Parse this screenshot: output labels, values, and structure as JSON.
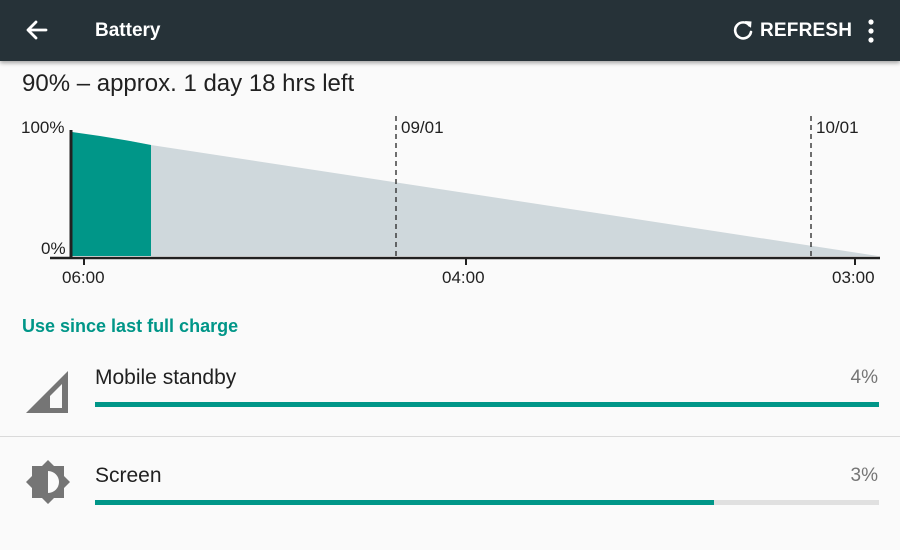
{
  "app": {
    "title": "Battery",
    "refresh_label": "REFRESH"
  },
  "summary": "90% – approx. 1 day 18 hrs left",
  "chart": {
    "y_top_label": "100%",
    "y_bottom_label": "0%",
    "x_labels": [
      "06:00",
      "04:00",
      "03:00"
    ],
    "date_labels": [
      "09/01",
      "10/01"
    ],
    "colors": {
      "used": "#009688",
      "projected": "#cfd8dc"
    }
  },
  "section_header": "Use since last full charge",
  "usage": [
    {
      "name": "Mobile standby",
      "percent": "4%",
      "bar_fill": 1.0,
      "icon": "cell-signal-icon"
    },
    {
      "name": "Screen",
      "percent": "3%",
      "bar_fill": 0.79,
      "icon": "brightness-icon"
    }
  ],
  "accent": "#009688",
  "appbar_color": "#263238"
}
